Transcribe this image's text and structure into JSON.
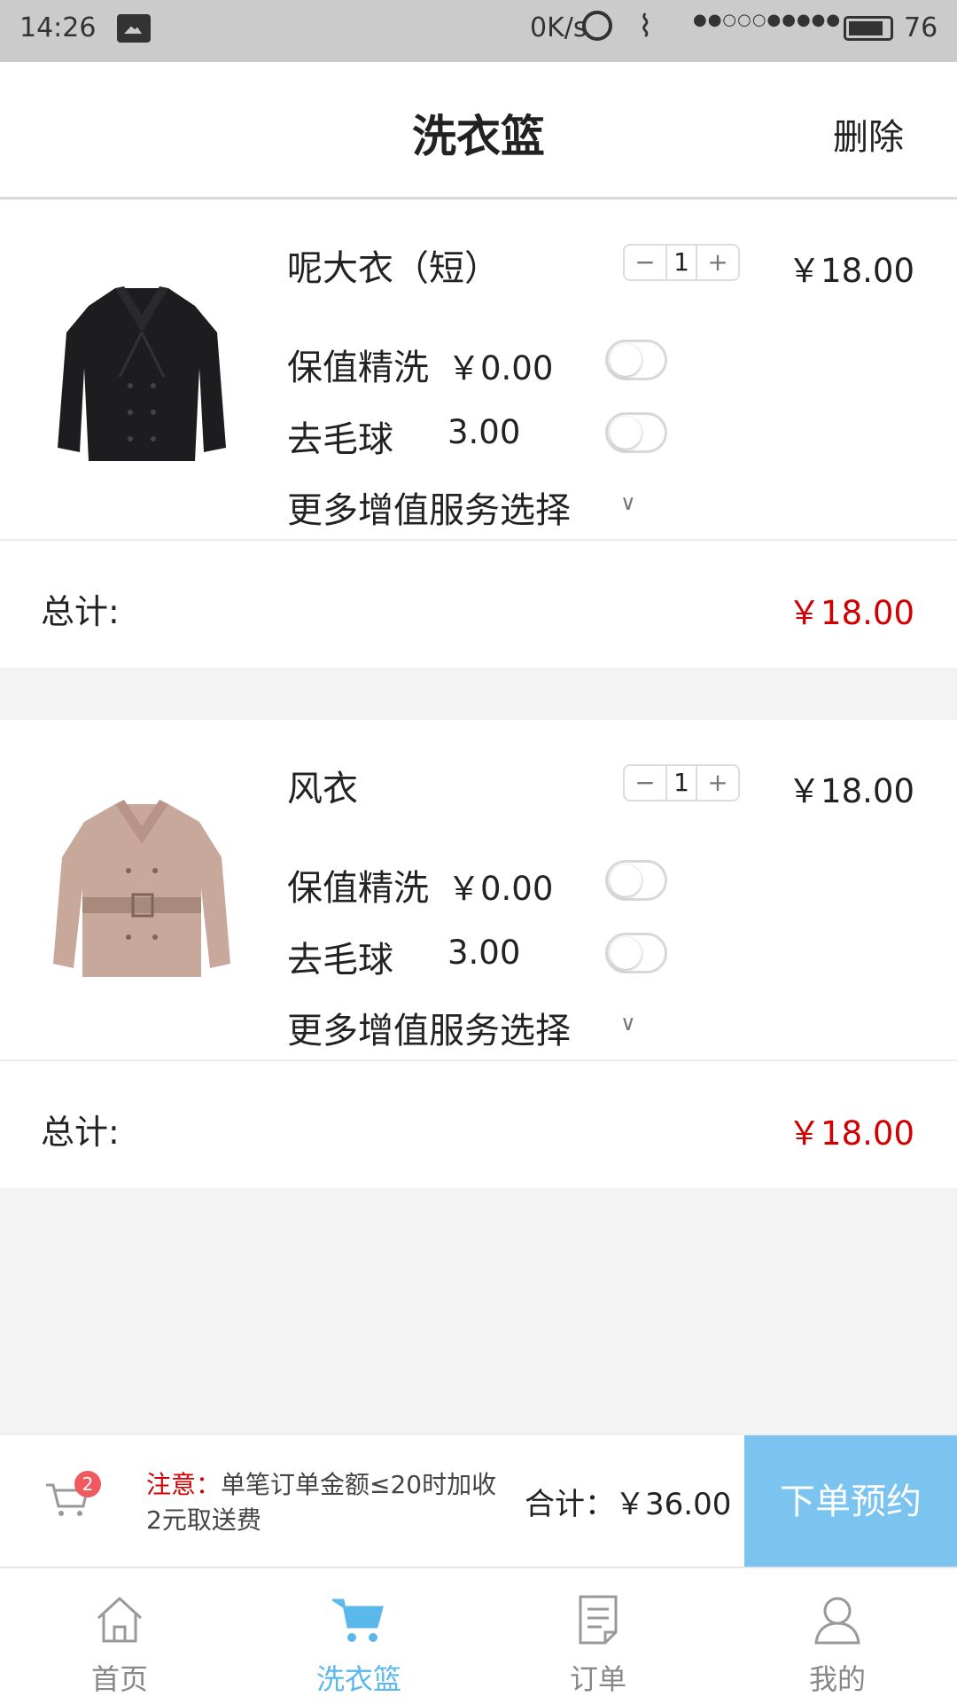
{
  "status_bar": {
    "time": "14:26",
    "net_speed": "0K/s",
    "battery": "76"
  },
  "header": {
    "title": "洗衣篮",
    "delete_label": "删除"
  },
  "items": [
    {
      "name": "呢大衣（短）",
      "quantity": "1",
      "price": "￥18.00",
      "options": [
        {
          "label": "保值精洗",
          "value": "￥0.00",
          "enabled": false
        },
        {
          "label": "去毛球",
          "value": "3.00",
          "enabled": false
        }
      ],
      "more_label": "更多增值服务选择",
      "total_label": "总计:",
      "total_value": "￥18.00"
    },
    {
      "name": "风衣",
      "quantity": "1",
      "price": "￥18.00",
      "options": [
        {
          "label": "保值精洗",
          "value": "￥0.00",
          "enabled": false
        },
        {
          "label": "去毛球",
          "value": "3.00",
          "enabled": false
        }
      ],
      "more_label": "更多增值服务选择",
      "total_label": "总计:",
      "total_value": "￥18.00"
    }
  ],
  "bottom_bar": {
    "cart_count": "2",
    "notice_prefix": "注意：",
    "notice_text": "单笔订单金额≤20时加收2元取送费",
    "sum_label": "合计：￥36.00",
    "order_button": "下单预约"
  },
  "tabs": [
    {
      "label": "首页",
      "icon": "home-icon",
      "active": false
    },
    {
      "label": "洗衣篮",
      "icon": "cart-icon",
      "active": true
    },
    {
      "label": "订单",
      "icon": "document-icon",
      "active": false
    },
    {
      "label": "我的",
      "icon": "user-icon",
      "active": false
    }
  ],
  "colors": {
    "accent": "#5bb8ea",
    "order_button": "#7cc4f0",
    "price_red": "#d20000"
  }
}
